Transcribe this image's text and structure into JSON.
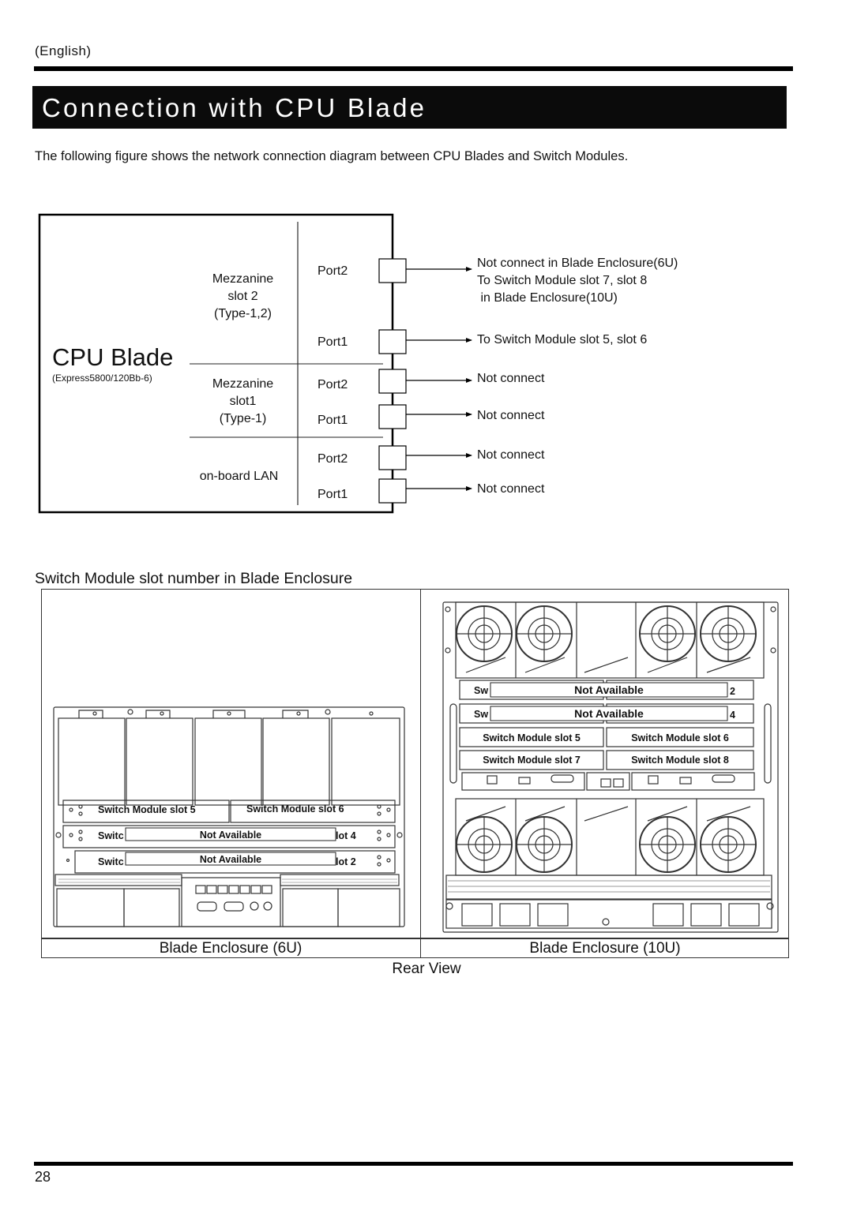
{
  "header": {
    "language": "(English)",
    "title": "Connection with CPU Blade",
    "intro": "The following figure shows the network connection diagram between CPU Blades and Switch Modules."
  },
  "cpu_diagram": {
    "title": "CPU Blade",
    "model": "(Express5800/120Bb-6)",
    "groups": [
      {
        "name_lines": [
          "Mezzanine",
          "slot 2",
          "(Type-1,2)"
        ],
        "ports": [
          {
            "label": "Port2",
            "destination_lines": [
              "Not connect in Blade Enclosure(6U)",
              "To Switch Module slot 7, slot 8",
              " in Blade Enclosure(10U)"
            ]
          },
          {
            "label": "Port1",
            "destination_lines": [
              "To Switch Module slot 5, slot 6"
            ]
          }
        ]
      },
      {
        "name_lines": [
          "Mezzanine",
          "slot1",
          "(Type-1)"
        ],
        "ports": [
          {
            "label": "Port2",
            "destination_lines": [
              "Not connect"
            ]
          },
          {
            "label": "Port1",
            "destination_lines": [
              "Not connect"
            ]
          }
        ]
      },
      {
        "name_lines": [
          "on-board LAN"
        ],
        "ports": [
          {
            "label": "Port2",
            "destination_lines": [
              "Not connect"
            ]
          },
          {
            "label": "Port1",
            "destination_lines": [
              "Not connect"
            ]
          }
        ]
      }
    ]
  },
  "enclosure_section": {
    "heading": "Switch Module slot number in Blade Enclosure",
    "enclosure_6u": {
      "caption": "Blade Enclosure (6U)",
      "slots": {
        "row1_left": "Switch Module slot 5",
        "row1_right": "Switch Module slot 6",
        "row2_left_stub": "Switc",
        "row2_right_stub": "lot 4",
        "row2_overlay": "Not Available",
        "row3_left_stub": "Switc",
        "row3_right_stub": "lot 2",
        "row3_overlay": "Not Available"
      }
    },
    "enclosure_10u": {
      "caption": "Blade Enclosure (10U)",
      "slots": {
        "row1_left_stub": "Sw",
        "row1_right_stub": "2",
        "row1_overlay": "Not Available",
        "row2_left_stub": "Sw",
        "row2_right_stub": "4",
        "row2_overlay": "Not Available",
        "row3_left": "Switch Module slot 5",
        "row3_right": "Switch Module slot 6",
        "row4_left": "Switch Module slot 7",
        "row4_right": "Switch Module slot 8"
      }
    },
    "view_caption": "Rear View"
  },
  "footer": {
    "page_number": "28"
  }
}
